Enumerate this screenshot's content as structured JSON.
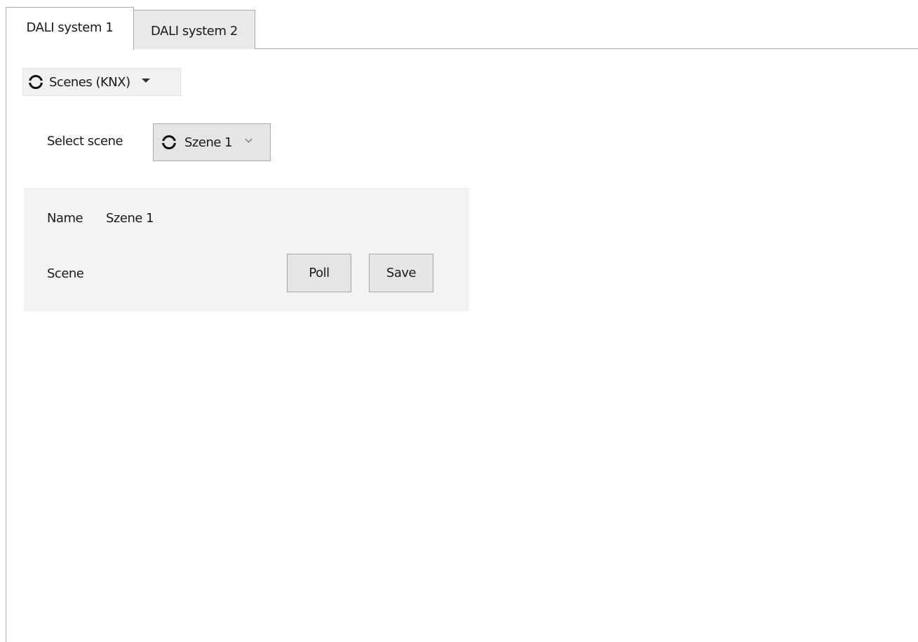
{
  "tabs": [
    {
      "label": "DALI system 1",
      "active": true
    },
    {
      "label": "DALI system 2",
      "active": false
    }
  ],
  "mode_selector": {
    "label": "Scenes (KNX)",
    "icon": "ring-icon"
  },
  "scene_selector": {
    "label": "Select scene",
    "selected": "Szene 1",
    "icon": "ring-icon"
  },
  "scene_panel": {
    "name_label": "Name",
    "name_value": "Szene 1",
    "scene_label": "Scene",
    "poll_label": "Poll",
    "save_label": "Save"
  },
  "colors": {
    "panel_background": "#f3f3f3",
    "button_background": "#e5e5e5",
    "inactive_tab_background": "#e9e9e9"
  }
}
